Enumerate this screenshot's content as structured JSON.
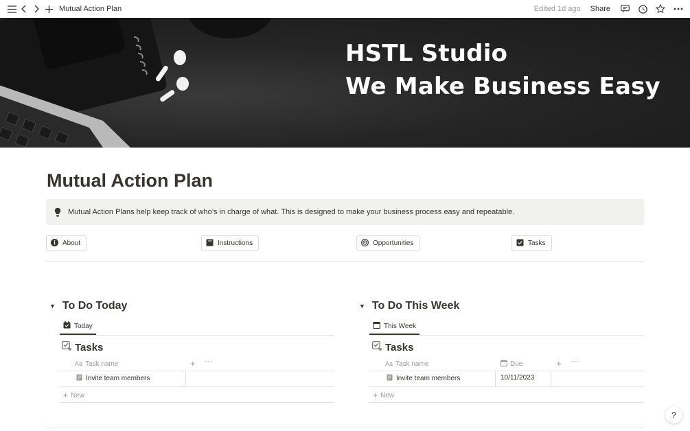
{
  "topbar": {
    "title": "Mutual Action Plan",
    "edited": "Edited 1d ago",
    "share": "Share"
  },
  "cover": {
    "line1": "HSTL Studio",
    "line2": "We Make Business Easy"
  },
  "page": {
    "title": "Mutual Action Plan",
    "callout": "Mutual Action Plans help keep track of who’s in charge of what.  This is designed to make your business process easy and repeatable."
  },
  "nav": [
    {
      "label": "About",
      "icon": "info-icon"
    },
    {
      "label": "Instructions",
      "icon": "book-icon"
    },
    {
      "label": "Opportunities",
      "icon": "target-icon"
    },
    {
      "label": "Tasks",
      "icon": "checkbox-icon"
    }
  ],
  "sections": [
    {
      "title": "To Do Today",
      "tab": "Today",
      "db_title": "Tasks",
      "col_name": "Task name",
      "rows": [
        {
          "name": "Invite team members"
        }
      ],
      "new": "New"
    },
    {
      "title": "To Do This Week",
      "tab": "This Week",
      "db_title": "Tasks",
      "col_name": "Task name",
      "col_due": "Due",
      "rows": [
        {
          "name": "Invite team members",
          "due": "10/11/2023"
        }
      ],
      "new": "New"
    }
  ],
  "help": "?",
  "colors": {
    "text": "#37352f",
    "muted": "#9b9a97",
    "callout_bg": "#f1f1ef",
    "border": "#e3e2e0"
  }
}
